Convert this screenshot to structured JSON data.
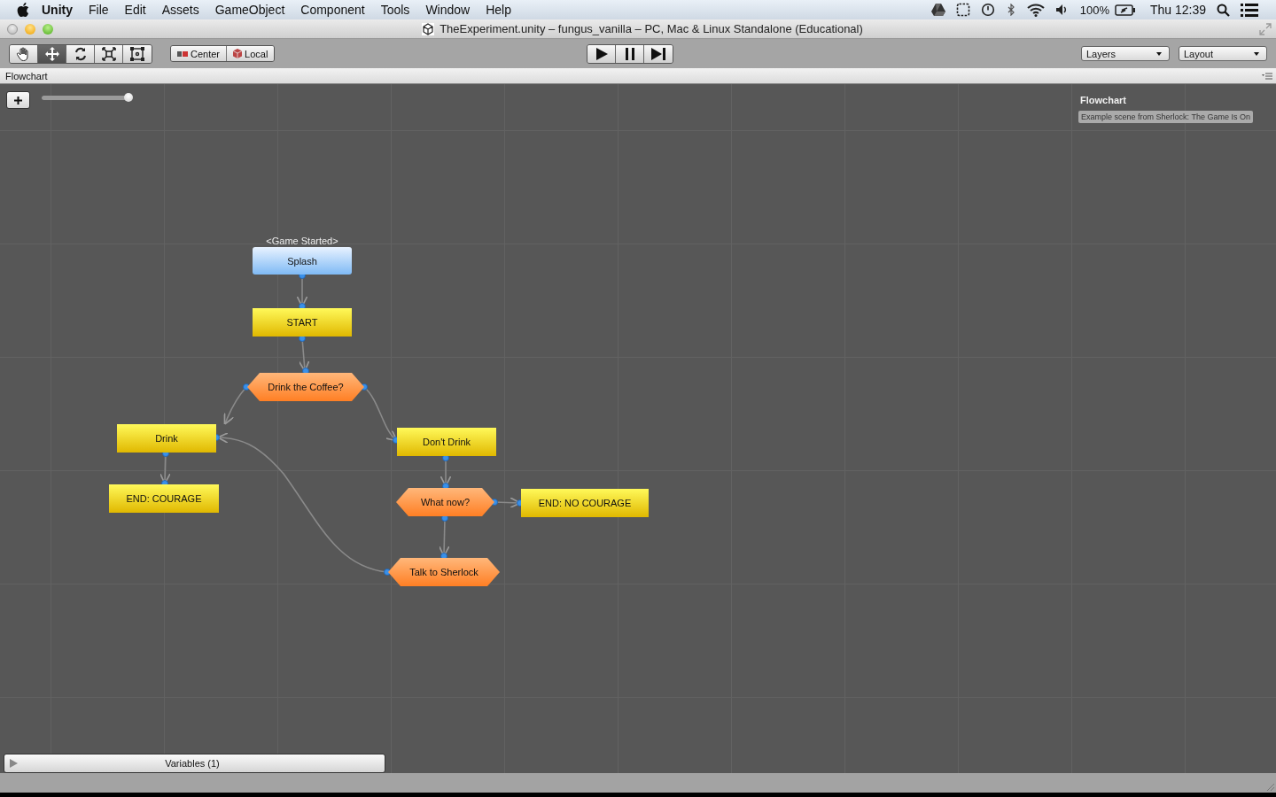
{
  "menu_bar": {
    "app": "Unity",
    "menus": [
      "File",
      "Edit",
      "Assets",
      "GameObject",
      "Component",
      "Tools",
      "Window",
      "Help"
    ],
    "battery": "100%",
    "clock": "Thu 12:39"
  },
  "window": {
    "title": "TheExperiment.unity – fungus_vanilla – PC, Mac & Linux Standalone (Educational)"
  },
  "toolbar": {
    "tools": [
      {
        "kind": "hand",
        "selected": false
      },
      {
        "kind": "move",
        "selected": true
      },
      {
        "kind": "rotate",
        "selected": false
      },
      {
        "kind": "scale",
        "selected": false
      },
      {
        "kind": "rect",
        "selected": false
      }
    ],
    "pivot": [
      {
        "kind": "center",
        "label": "Center"
      },
      {
        "kind": "local",
        "label": "Local"
      }
    ],
    "playback": [
      {
        "kind": "play"
      },
      {
        "kind": "pause"
      },
      {
        "kind": "step"
      }
    ],
    "dropdowns": [
      "Layers",
      "Layout"
    ]
  },
  "tab": {
    "label": "Flowchart"
  },
  "canvas": {
    "zoom": {
      "level": 0.98
    },
    "info": {
      "title": "Flowchart",
      "description": "Example scene from Sherlock: The Game Is On"
    },
    "nodes": [
      {
        "kind": "event",
        "label": "Splash",
        "event": "<Game Started>"
      },
      {
        "kind": "block",
        "label": "START"
      },
      {
        "kind": "question",
        "label": "Drink the Coffee?"
      },
      {
        "kind": "block",
        "label": "Drink"
      },
      {
        "kind": "block",
        "label": "Don't Drink"
      },
      {
        "kind": "block",
        "label": "END: COURAGE"
      },
      {
        "kind": "question",
        "label": "What now?"
      },
      {
        "kind": "block",
        "label": "END: NO COURAGE"
      },
      {
        "kind": "question",
        "label": "Talk to Sherlock"
      }
    ],
    "variables": {
      "label": "Variables (1)",
      "expanded": false
    }
  }
}
